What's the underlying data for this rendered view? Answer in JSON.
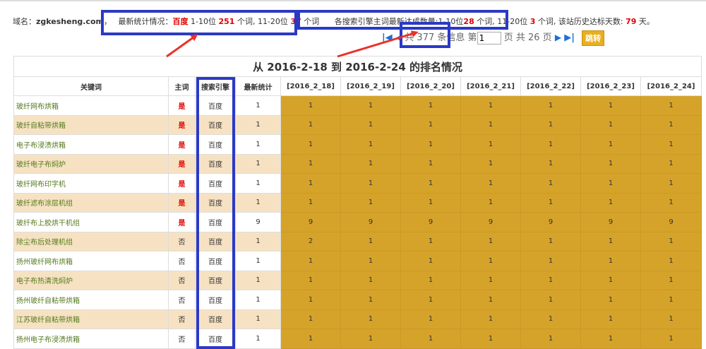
{
  "summary": {
    "domain_label": "域名：",
    "domain": "zgkesheng.com",
    "sep": "，",
    "latest_label": "最新统计情况：",
    "engine": "百度",
    "r1_label": "1-10位",
    "r1_count": "251",
    "r1_unit": "个词,",
    "r2_label": "11-20位",
    "r2_count": "37",
    "r2_unit": "个词",
    "reach_label": "各搜索引擎主词最新达成数量:1-10位",
    "reach_r1": "28",
    "reach_r1_unit": "个词,",
    "reach_r2_label": "11-20位",
    "reach_r2": "3",
    "reach_r2_unit": "个词,",
    "history_label": "该站历史达标天数:",
    "history_days": "79",
    "history_unit": "天。"
  },
  "pager": {
    "total_prefix": "共",
    "total": "377",
    "total_suffix": "条信息",
    "page_prefix": "第",
    "page_value": "1",
    "page_mid": "页 共",
    "page_total": "26",
    "page_suffix": "页",
    "go_label": "跳转"
  },
  "table": {
    "title": "从 2016-2-18 到 2016-2-24 的排名情况",
    "headers": [
      "关键词",
      "主词",
      "搜索引擎",
      "最新统计",
      "[2016_2_18]",
      "[2016_2_19]",
      "[2016_2_20]",
      "[2016_2_21]",
      "[2016_2_22]",
      "[2016_2_23]",
      "[2016_2_24]"
    ],
    "rows": [
      {
        "keyword": "玻纤网布烘箱",
        "main": "是",
        "engine": "百度",
        "latest": "1",
        "days": [
          "1",
          "1",
          "1",
          "1",
          "1",
          "1",
          "1"
        ]
      },
      {
        "keyword": "玻纤自粘带烘箱",
        "main": "是",
        "engine": "百度",
        "latest": "1",
        "days": [
          "1",
          "1",
          "1",
          "1",
          "1",
          "1",
          "1"
        ]
      },
      {
        "keyword": "电子布浸渍烘箱",
        "main": "是",
        "engine": "百度",
        "latest": "1",
        "days": [
          "1",
          "1",
          "1",
          "1",
          "1",
          "1",
          "1"
        ]
      },
      {
        "keyword": "玻纤电子布焖炉",
        "main": "是",
        "engine": "百度",
        "latest": "1",
        "days": [
          "1",
          "1",
          "1",
          "1",
          "1",
          "1",
          "1"
        ]
      },
      {
        "keyword": "玻纤网布印字机",
        "main": "是",
        "engine": "百度",
        "latest": "1",
        "days": [
          "1",
          "1",
          "1",
          "1",
          "1",
          "1",
          "1"
        ]
      },
      {
        "keyword": "玻纤滤布涂层机组",
        "main": "是",
        "engine": "百度",
        "latest": "1",
        "days": [
          "1",
          "1",
          "1",
          "1",
          "1",
          "1",
          "1"
        ]
      },
      {
        "keyword": "玻纤布上胶烘干机组",
        "main": "是",
        "engine": "百度",
        "latest": "9",
        "days": [
          "9",
          "9",
          "9",
          "9",
          "9",
          "9",
          "9"
        ]
      },
      {
        "keyword": "除尘布后处理机组",
        "main": "否",
        "engine": "百度",
        "latest": "1",
        "days": [
          "2",
          "1",
          "1",
          "1",
          "1",
          "1",
          "1"
        ]
      },
      {
        "keyword": "扬州玻纤网布烘箱",
        "main": "否",
        "engine": "百度",
        "latest": "1",
        "days": [
          "1",
          "1",
          "1",
          "1",
          "1",
          "1",
          "1"
        ]
      },
      {
        "keyword": "电子布热清洗焖炉",
        "main": "否",
        "engine": "百度",
        "latest": "1",
        "days": [
          "1",
          "1",
          "1",
          "1",
          "1",
          "1",
          "1"
        ]
      },
      {
        "keyword": "扬州玻纤自粘带烘箱",
        "main": "否",
        "engine": "百度",
        "latest": "1",
        "days": [
          "1",
          "1",
          "1",
          "1",
          "1",
          "1",
          "1"
        ]
      },
      {
        "keyword": "江苏玻纤自粘带烘箱",
        "main": "否",
        "engine": "百度",
        "latest": "1",
        "days": [
          "1",
          "1",
          "1",
          "1",
          "1",
          "1",
          "1"
        ]
      },
      {
        "keyword": "扬州电子布浸渍烘箱",
        "main": "否",
        "engine": "百度",
        "latest": "1",
        "days": [
          "1",
          "1",
          "1",
          "1",
          "1",
          "1",
          "1"
        ]
      }
    ]
  },
  "colors": {
    "annotation_box": "#2b39c6",
    "annotation_arrow": "#e8322a",
    "day_cell": "#d6a32a",
    "alt_row": "#f6e2c2",
    "red_value": "#e00000"
  }
}
